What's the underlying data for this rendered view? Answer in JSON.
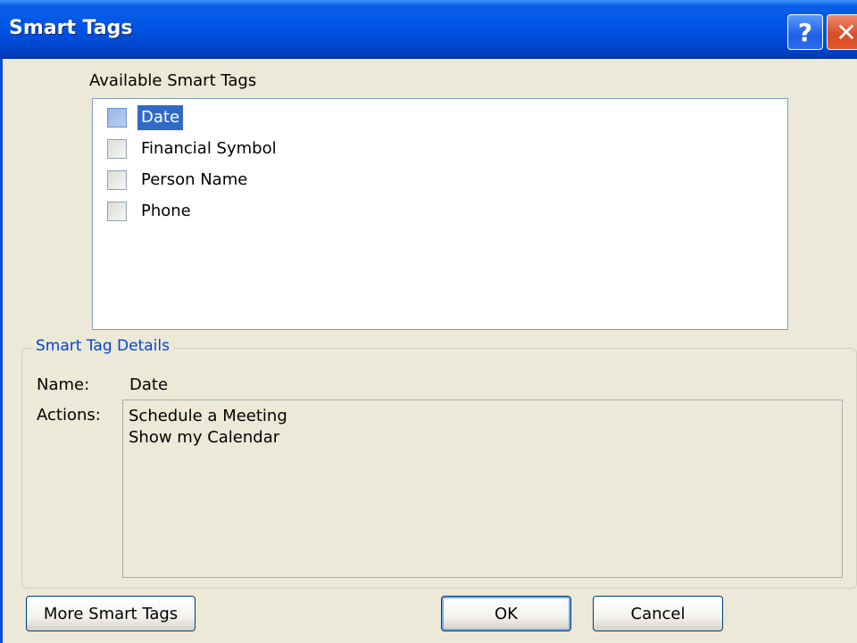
{
  "window": {
    "title": "Smart Tags",
    "help_glyph": "?",
    "close_glyph": "✕"
  },
  "available": {
    "label": "Available Smart Tags",
    "items": [
      {
        "label": "Date",
        "selected": true
      },
      {
        "label": "Financial Symbol",
        "selected": false
      },
      {
        "label": "Person Name",
        "selected": false
      },
      {
        "label": "Phone",
        "selected": false
      }
    ]
  },
  "details": {
    "legend": "Smart Tag Details",
    "name_label": "Name:",
    "name_value": "Date",
    "actions_label": "Actions:",
    "actions": [
      "Schedule a Meeting",
      "Show my Calendar"
    ]
  },
  "buttons": {
    "more": "More Smart Tags",
    "ok": "OK",
    "cancel": "Cancel"
  },
  "colors": {
    "titlebar": "#0055E5",
    "selection": "#316AC5",
    "legend": "#0046D5",
    "dialog_bg": "#ECE9D8"
  }
}
